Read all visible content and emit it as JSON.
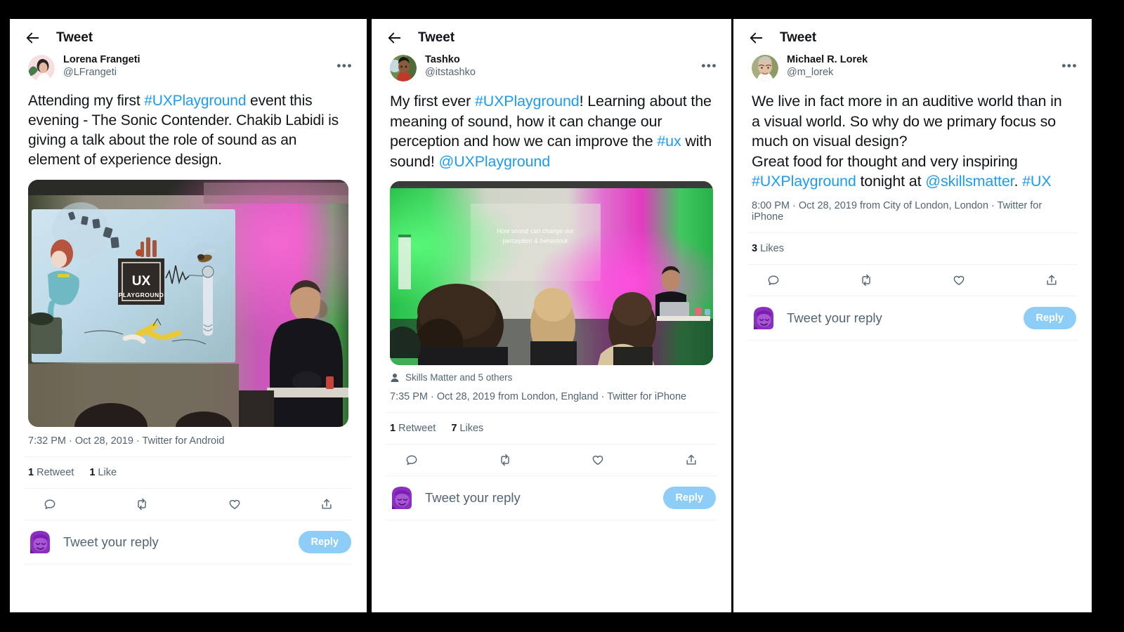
{
  "window": {
    "background_color": "#000000",
    "panel_background": "#ffffff",
    "link_color": "#1d9bf0",
    "muted_text_color": "#536471",
    "primary_text_color": "#0f1419",
    "reply_button_color": "#8ecdf8",
    "divider_color": "#eff3f4"
  },
  "panels": [
    {
      "header": {
        "title": "Tweet",
        "back_icon": "back-arrow-icon"
      },
      "author": {
        "name": "Lorena Frangeti",
        "handle": "@LFrangeti",
        "avatar": "woman-dark-hair-pink-background-avatar",
        "more_icon": "more-options-icon"
      },
      "text_parts": [
        {
          "t": "Attending my first ",
          "link": false
        },
        {
          "t": "#UXPlayground",
          "link": true
        },
        {
          "t": " event this evening - The Sonic Contender. Chakib Labidi is giving a talk about the role of sound as an element of experience design.",
          "link": false
        }
      ],
      "media": {
        "alt": "speaker presenting beside projected UX Playground slide with magenta and green stage lighting",
        "slide_logo_line1": "UX",
        "slide_logo_line2": "PLAYGROUND"
      },
      "tagged": null,
      "meta": "7:32 PM · Oct 28, 2019 · Twitter for Android",
      "stats": [
        {
          "count": "1",
          "label": "Retweet"
        },
        {
          "count": "1",
          "label": "Like"
        }
      ],
      "actions": [
        "reply-icon",
        "retweet-icon",
        "like-icon",
        "share-icon"
      ],
      "composer": {
        "avatar": "purple-memoji-avatar",
        "placeholder": "Tweet your reply",
        "button_label": "Reply"
      }
    },
    {
      "header": {
        "title": "Tweet",
        "back_icon": "back-arrow-icon"
      },
      "author": {
        "name": "Tashko",
        "handle": "@itstashko",
        "avatar": "man-red-shirt-outdoor-avatar",
        "more_icon": "more-options-icon"
      },
      "text_parts": [
        {
          "t": "My first ever ",
          "link": false
        },
        {
          "t": "#UXPlayground",
          "link": true
        },
        {
          "t": "! Learning about the meaning of sound, how it can change our perception and how we can improve the ",
          "link": false
        },
        {
          "t": "#ux",
          "link": true
        },
        {
          "t": " with sound! ",
          "link": false
        },
        {
          "t": "@UXPlayground",
          "link": true
        }
      ],
      "media": {
        "alt": "audience watching a presentation slide with green and magenta lighting",
        "slide_line1": "How sound can change our",
        "slide_line2": "perception & behaviour"
      },
      "tagged": {
        "icon": "person-icon",
        "label": "Skills Matter and 5 others"
      },
      "meta": "7:35 PM · Oct 28, 2019 from London, England · Twitter for iPhone",
      "stats": [
        {
          "count": "1",
          "label": "Retweet"
        },
        {
          "count": "7",
          "label": "Likes"
        }
      ],
      "actions": [
        "reply-icon",
        "retweet-icon",
        "like-icon",
        "share-icon"
      ],
      "composer": {
        "avatar": "purple-memoji-avatar",
        "placeholder": "Tweet your reply",
        "button_label": "Reply"
      }
    },
    {
      "header": {
        "title": "Tweet",
        "back_icon": "back-arrow-icon"
      },
      "author": {
        "name": "Michael R. Lorek",
        "handle": "@m_lorek",
        "avatar": "older-man-glasses-avatar",
        "more_icon": "more-options-icon"
      },
      "text_parts": [
        {
          "t": "We live in fact more in an auditive world than in a visual world. So why do we primary focus so much on visual design?\nGreat food for thought and very inspiring ",
          "link": false
        },
        {
          "t": "#UXPlayground",
          "link": true
        },
        {
          "t": " tonight at ",
          "link": false
        },
        {
          "t": "@skillsmatter",
          "link": true
        },
        {
          "t": ". ",
          "link": false
        },
        {
          "t": "#UX",
          "link": true
        }
      ],
      "media": null,
      "tagged": null,
      "meta": "8:00 PM · Oct 28, 2019 from City of London, London · Twitter for iPhone",
      "stats": [
        {
          "count": "3",
          "label": "Likes"
        }
      ],
      "actions": [
        "reply-icon",
        "retweet-icon",
        "like-icon",
        "share-icon"
      ],
      "composer": {
        "avatar": "purple-memoji-avatar",
        "placeholder": "Tweet your reply",
        "button_label": "Reply"
      }
    }
  ]
}
